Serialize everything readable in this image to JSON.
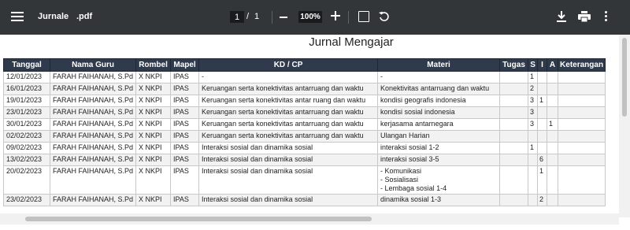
{
  "toolbar": {
    "file_name": "Jurnale",
    "file_ext": ".pdf",
    "current_page": "1",
    "page_separator": "/",
    "total_pages": "1",
    "zoom": "100%",
    "icons": [
      "menu-icon",
      "minus-icon",
      "plus-icon",
      "fit-page-icon",
      "rotate-icon",
      "download-icon",
      "print-icon",
      "more-vert-icon"
    ]
  },
  "document": {
    "title": "Jurnal Mengajar",
    "columns": [
      "Tanggal",
      "Nama Guru",
      "Rombel",
      "Mapel",
      "KD / CP",
      "Materi",
      "Tugas",
      "S",
      "I",
      "A",
      "Keterangan"
    ],
    "rows": [
      {
        "tanggal": "12/01/2023",
        "guru": "FARAH FAIHANAH, S.Pd",
        "rombel": "X NKPI",
        "mapel": "IPAS",
        "kd": "-",
        "materi": [
          "-"
        ],
        "tugas": "",
        "s": "1",
        "i": "",
        "a": "",
        "ket": ""
      },
      {
        "tanggal": "16/01/2023",
        "guru": "FARAH FAIHANAH, S.Pd",
        "rombel": "X NKPI",
        "mapel": "IPAS",
        "kd": "Keruangan serta konektivitas antarruang dan waktu",
        "materi": [
          "Konektivitas antarruang dan waktu"
        ],
        "tugas": "",
        "s": "2",
        "i": "",
        "a": "",
        "ket": ""
      },
      {
        "tanggal": "19/01/2023",
        "guru": "FARAH FAIHANAH, S.Pd",
        "rombel": "X NKPI",
        "mapel": "IPAS",
        "kd": "Keruangan serta konektivitas antar ruang dan waktu",
        "materi": [
          "kondisi geografis indonesia"
        ],
        "tugas": "",
        "s": "3",
        "i": "1",
        "a": "",
        "ket": ""
      },
      {
        "tanggal": "23/01/2023",
        "guru": "FARAH FAIHANAH, S.Pd",
        "rombel": "X NKPI",
        "mapel": "IPAS",
        "kd": "Keruangan serta konektivitas antarruang dan waktu",
        "materi": [
          "kondisi sosial indonesia"
        ],
        "tugas": "",
        "s": "3",
        "i": "",
        "a": "",
        "ket": ""
      },
      {
        "tanggal": "30/01/2023",
        "guru": "FARAH FAIHANAH, S.Pd",
        "rombel": "X NKPI",
        "mapel": "IPAS",
        "kd": "Keruangan serta konektivitas antarruang dan waktu",
        "materi": [
          "kerjasama antarnegara"
        ],
        "tugas": "",
        "s": "3",
        "i": "",
        "a": "1",
        "ket": ""
      },
      {
        "tanggal": "02/02/2023",
        "guru": "FARAH FAIHANAH, S.Pd",
        "rombel": "X NKPI",
        "mapel": "IPAS",
        "kd": "Keruangan serta konektivitas antarruang dan waktu",
        "materi": [
          "Ulangan Harian"
        ],
        "tugas": "",
        "s": "",
        "i": "",
        "a": "",
        "ket": ""
      },
      {
        "tanggal": "09/02/2023",
        "guru": "FARAH FAIHANAH, S.Pd",
        "rombel": "X NKPI",
        "mapel": "IPAS",
        "kd": "Interaksi sosial dan dinamika sosial",
        "materi": [
          "interaksi sosial 1-2"
        ],
        "tugas": "",
        "s": "1",
        "i": "",
        "a": "",
        "ket": ""
      },
      {
        "tanggal": "13/02/2023",
        "guru": "FARAH FAIHANAH, S.Pd",
        "rombel": "X NKPI",
        "mapel": "IPAS",
        "kd": "Interaksi sosial dan dinamika sosial",
        "materi": [
          "interaksi sosial 3-5"
        ],
        "tugas": "",
        "s": "",
        "i": "6",
        "a": "",
        "ket": ""
      },
      {
        "tanggal": "20/02/2023",
        "guru": "FARAH FAIHANAH, S.Pd",
        "rombel": "X NKPI",
        "mapel": "IPAS",
        "kd": "Interaksi sosial dan dinamika sosial",
        "materi": [
          "- Komunikasi",
          "- Sosialisasi",
          "- Lembaga sosial 1-4"
        ],
        "tugas": "",
        "s": "",
        "i": "1",
        "a": "",
        "ket": ""
      },
      {
        "tanggal": "23/02/2023",
        "guru": "FARAH FAIHANAH, S.Pd",
        "rombel": "X NKPI",
        "mapel": "IPAS",
        "kd": "Interaksi sosial dan dinamika sosial",
        "materi": [
          "dinamika sosial 1-3"
        ],
        "tugas": "",
        "s": "",
        "i": "2",
        "a": "",
        "ket": ""
      }
    ]
  }
}
